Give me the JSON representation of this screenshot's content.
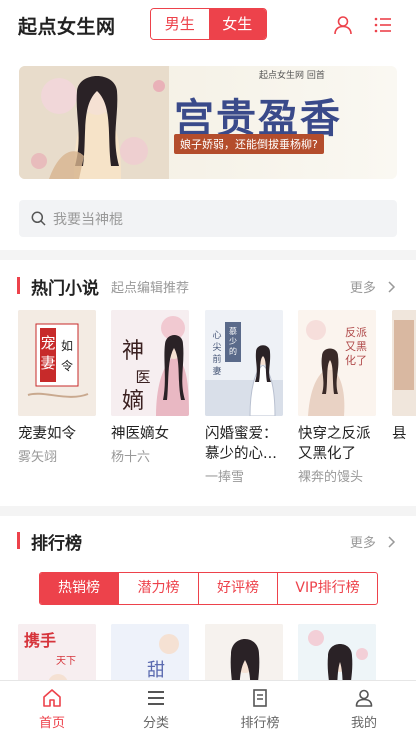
{
  "header": {
    "logo": "起点女生网",
    "gender_male": "男生",
    "gender_female": "女生"
  },
  "banner": {
    "title": "宫贵盈香",
    "brand": "起点女生网 回首",
    "slogan": "娘子娇弱，还能倒拔垂杨柳?"
  },
  "search": {
    "placeholder": "我要当神棍"
  },
  "hot": {
    "title": "热门小说",
    "subtitle": "起点编辑推荐",
    "more": "更多",
    "books": [
      {
        "name": "宠妻如令",
        "author": "雾矢翊",
        "cover_text": "宠妻如令",
        "cover_bg": "#f3ebe3",
        "cover_accent": "#c72a2a"
      },
      {
        "name": "神医嫡女",
        "author": "杨十六",
        "cover_text": "神医嫡女",
        "cover_bg": "#f6eef0",
        "cover_accent": "#6b2a2a"
      },
      {
        "name": "闪婚蜜爱：慕少的心...",
        "author": "一捧雪",
        "cover_text": "慕少的心尖前妻",
        "cover_bg": "#eef1f6",
        "cover_accent": "#4a5a7a"
      },
      {
        "name": "快穿之反派又黑化了",
        "author": "裸奔的馒头",
        "cover_text": "反派又黑化了",
        "cover_bg": "#fbf4ee",
        "cover_accent": "#b04a4a"
      },
      {
        "name": "县",
        "author": "",
        "cover_text": "",
        "cover_bg": "#f0e6dc",
        "cover_accent": "#a55"
      }
    ]
  },
  "rank": {
    "title": "排行榜",
    "more": "更多",
    "tabs": [
      "热销榜",
      "潜力榜",
      "好评榜",
      "VIP排行榜"
    ],
    "books": [
      {
        "cover_text": "携手天下小狼奴",
        "cover_bg": "#f7eef0",
        "cover_accent": "#d6343b"
      },
      {
        "cover_text": "甜蜜之家",
        "cover_bg": "#eef2fa",
        "cover_accent": "#5a6ab0"
      },
      {
        "cover_text": "",
        "cover_bg": "#f6f2ee",
        "cover_accent": "#8a6a5a"
      },
      {
        "cover_text": "",
        "cover_bg": "#eef5f8",
        "cover_accent": "#c06a7a"
      }
    ]
  },
  "nav": {
    "items": [
      {
        "label": "首页",
        "icon": "home-icon",
        "active": true
      },
      {
        "label": "分类",
        "icon": "category-icon",
        "active": false
      },
      {
        "label": "排行榜",
        "icon": "ranking-icon",
        "active": false
      },
      {
        "label": "我的",
        "icon": "user-icon",
        "active": false
      }
    ]
  },
  "colors": {
    "accent": "#ed424b"
  }
}
